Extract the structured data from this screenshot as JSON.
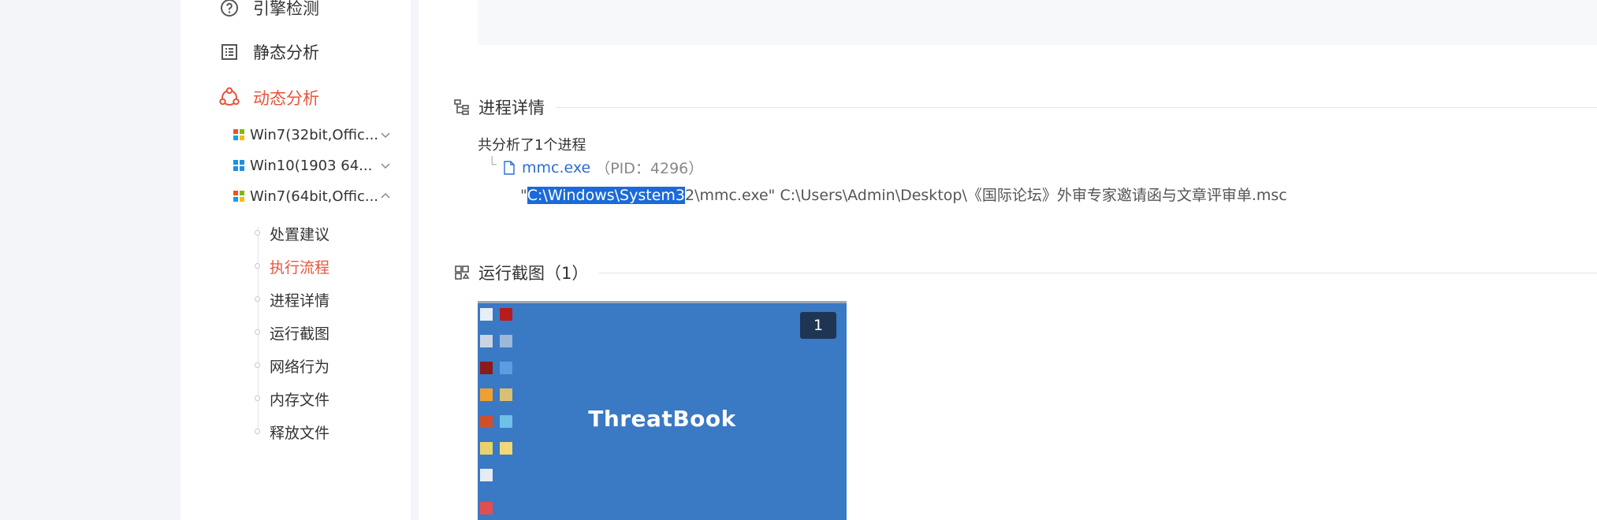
{
  "sidebar": {
    "nav": [
      {
        "label": "引擎检测",
        "icon": "question-circle-icon"
      },
      {
        "label": "静态分析",
        "icon": "list-icon"
      },
      {
        "label": "动态分析",
        "icon": "share-nodes-icon",
        "active": true
      }
    ],
    "environments": [
      {
        "label": "Win7(32bit,Offic...",
        "icon": "windows-logo-icon",
        "expanded": false
      },
      {
        "label": "Win10(1903 64...",
        "icon": "windows10-logo-icon",
        "expanded": false
      },
      {
        "label": "Win7(64bit,Offic...",
        "icon": "windows-logo-icon",
        "expanded": true
      }
    ],
    "subitems": [
      {
        "label": "处置建议"
      },
      {
        "label": "执行流程",
        "active": true
      },
      {
        "label": "进程详情"
      },
      {
        "label": "运行截图"
      },
      {
        "label": "网络行为"
      },
      {
        "label": "内存文件"
      },
      {
        "label": "释放文件"
      }
    ]
  },
  "process_section": {
    "title": "进程详情",
    "count_text": "共分析了1个进程",
    "process_name": "mmc.exe",
    "pid_text": "（PID：4296）",
    "cmd_prefix": "\"",
    "cmd_highlight": "C:\\Windows\\System3",
    "cmd_rest": "2\\mmc.exe\" C:\\Users\\Admin\\Desktop\\《国际论坛》外审专家邀请函与文章评审单.msc"
  },
  "screenshot_section": {
    "title": "运行截图（1）",
    "badge": "1",
    "brand": "ThreatBook"
  },
  "colors": {
    "accent": "#e8553b",
    "link": "#2c6dd2",
    "highlight": "#1b6ad8",
    "desktop": "#3a79c4"
  }
}
